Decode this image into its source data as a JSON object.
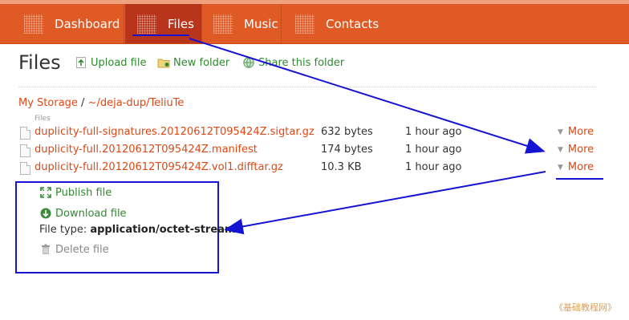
{
  "nav": {
    "tabs": [
      {
        "label": "Dashboard",
        "icon": "grid-icon",
        "active": false
      },
      {
        "label": "Files",
        "icon": "grid-icon",
        "active": true
      },
      {
        "label": "Music",
        "icon": "grid-icon",
        "active": false
      },
      {
        "label": "Contacts",
        "icon": "grid-icon",
        "active": false
      }
    ]
  },
  "header": {
    "title": "Files",
    "upload_label": "Upload file",
    "new_folder_label": "New folder",
    "share_label": "Share this folder"
  },
  "breadcrumb": {
    "root": "My Storage",
    "separator": "/",
    "path": "~/deja-dup/TeliuTe"
  },
  "files": {
    "header": "Files",
    "rows": [
      {
        "name": "duplicity-full-signatures.20120612T095424Z.sigtar.gz",
        "size": "632 bytes",
        "date": "1 hour ago",
        "more": "More"
      },
      {
        "name": "duplicity-full.20120612T095424Z.manifest",
        "size": "174 bytes",
        "date": "1 hour ago",
        "more": "More"
      },
      {
        "name": "duplicity-full.20120612T095424Z.vol1.difftar.gz",
        "size": "10.3 KB",
        "date": "1 hour ago",
        "more": "More"
      }
    ]
  },
  "details": {
    "publish_label": "Publish file",
    "download_label": "Download file",
    "filetype_label": "File type:",
    "filetype_value": "application/octet-stream",
    "delete_label": "Delete file"
  },
  "watermark": "《基础教程网》",
  "colors": {
    "nav_bg": "#e05a25",
    "nav_active": "#b8341a",
    "link_orange": "#dd4814",
    "action_green": "#2e8a2e",
    "annotation_blue": "#1414d2"
  }
}
